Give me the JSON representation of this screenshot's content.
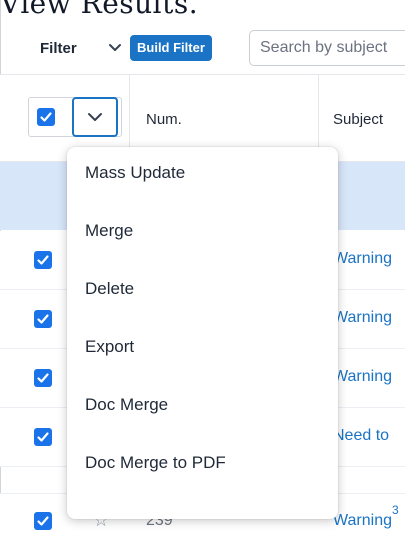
{
  "page": {
    "heading": "View Results."
  },
  "toolbar": {
    "filter_label": "Filter",
    "build_filter_label": "Build Filter",
    "search_placeholder": "Search by subject"
  },
  "table": {
    "columns": [
      "Num.",
      "Subject"
    ],
    "header_select_all_checked": true,
    "rows": [
      {
        "checked": true,
        "starred": false,
        "num": "",
        "subject": "Warning"
      },
      {
        "checked": true,
        "starred": false,
        "num": "",
        "subject": "Warning"
      },
      {
        "checked": true,
        "starred": false,
        "num": "",
        "subject": "Warning"
      },
      {
        "checked": true,
        "starred": false,
        "num": "",
        "subject": "Need to"
      },
      {
        "checked": true,
        "starred": false,
        "num": "239",
        "subject": "Warning",
        "superscript": "3"
      }
    ]
  },
  "menu": {
    "items": [
      "Mass Update",
      "Merge",
      "Delete",
      "Export",
      "Doc Merge",
      "Doc Merge to PDF"
    ]
  },
  "colors": {
    "accent": "#1a73c4",
    "checkbox": "#1a73e8",
    "selected_row": "#d7e6f9",
    "link": "#1a73c4"
  }
}
